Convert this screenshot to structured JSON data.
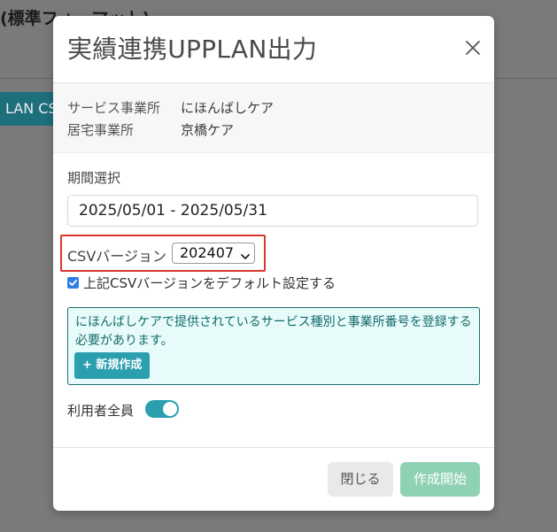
{
  "background": {
    "title": "(標準フォーマット)",
    "button_label": "LAN CSV"
  },
  "modal": {
    "title": "実績連携UPPLAN出力",
    "close_icon": "close-icon",
    "office": {
      "service_label": "サービス事業所",
      "service_value": "にほんばしケア",
      "home_label": "居宅事業所",
      "home_value": "京橋ケア"
    },
    "period": {
      "label": "期間選択",
      "value": "2025/05/01 - 2025/05/31"
    },
    "csv": {
      "label": "CSVバージョン",
      "selected": "202407"
    },
    "default_checkbox": {
      "label": "上記CSVバージョンをデフォルト設定する",
      "checked": true
    },
    "alert": {
      "message": "にほんばしケアで提供されているサービス種別と事業所番号を登録する必要があります。",
      "button_label": "+ 新規作成"
    },
    "all_users": {
      "label": "利用者全員",
      "on": true
    },
    "footer": {
      "close_label": "閉じる",
      "start_label": "作成開始"
    }
  },
  "colors": {
    "accent": "#2b9eb0",
    "highlight_border": "#d9362b",
    "start_button": "#8fd1b3",
    "overlay": "#7a7a7a"
  }
}
